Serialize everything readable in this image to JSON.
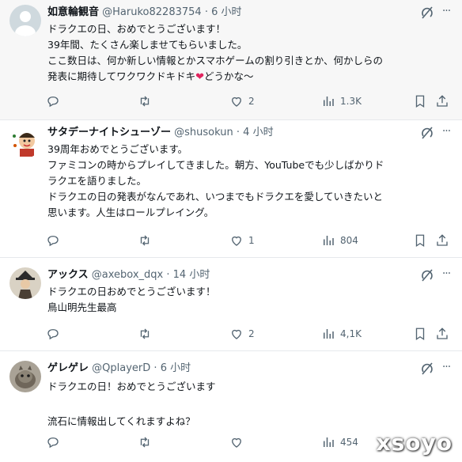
{
  "tweets": [
    {
      "name": "如意輪観音",
      "handle": "@Haruko82283754",
      "dot": "·",
      "time": "6 小时",
      "lines": [
        "ドラクエの日、おめでとうございます！",
        "39年間、たくさん楽しませてもらいました。",
        "ここ数日は、何か新しい情報とかスマホゲームの割り引きとか、何かしらの",
        "発表に期待してワクワクドキドキ"
      ],
      "line_tail": "どうかな〜",
      "replies": "",
      "retweets": "",
      "likes": "2",
      "views": "1.3K"
    },
    {
      "name": "サタデーナイトシューゾー",
      "handle": "@shusokun",
      "dot": "·",
      "time": "4 小时",
      "lines": [
        "39周年おめでとうございます。",
        "ファミコンの時からプレイしてきました。朝方、YouTubeでも少しばかりド",
        "ラクエを語りました。",
        "ドラクエの日の発表がなんであれ、いつまでもドラクエを愛していきたいと",
        "思います。人生はロールプレイング。"
      ],
      "replies": "",
      "retweets": "",
      "likes": "1",
      "views": "804"
    },
    {
      "name": "アックス",
      "handle": "@axebox_dqx",
      "dot": "·",
      "time": "14 小时",
      "lines": [
        "ドラクエの日おめでとうございます！",
        "鳥山明先生最高"
      ],
      "replies": "",
      "retweets": "",
      "likes": "2",
      "views": "4,1K"
    },
    {
      "name": "ゲレゲレ",
      "handle": "@QplayerD",
      "dot": "·",
      "time": "6 小时",
      "lines": [
        "ドラクエの日！おめでとうございます",
        "",
        "流石に情報出してくれますよね？"
      ],
      "replies": "",
      "retweets": "",
      "likes": "",
      "views": "454"
    }
  ],
  "watermark": "xsoyo",
  "colors": {
    "text": "#0f1419",
    "muted": "#536471",
    "heart": "#e0245e",
    "divider": "#e6e9ec"
  },
  "icons": [
    "grok-icon",
    "more-icon",
    "reply-icon",
    "retweet-icon",
    "like-icon",
    "views-icon",
    "bookmark-icon",
    "share-icon"
  ]
}
